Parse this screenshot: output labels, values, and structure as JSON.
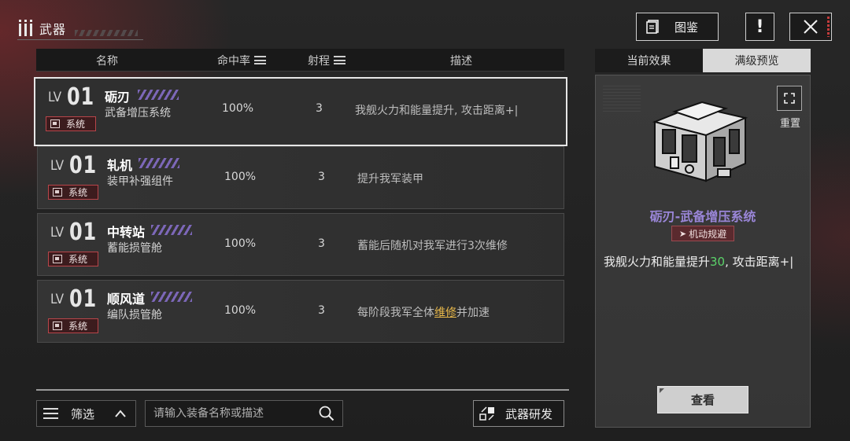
{
  "header": {
    "title": "武器",
    "atlas_label": "图鉴",
    "alert_label": "!"
  },
  "table": {
    "columns": {
      "name": "名称",
      "hit": "命中率",
      "range": "射程",
      "desc": "描述"
    },
    "rows": [
      {
        "lv": "LV",
        "lv_num": "01",
        "name": "砺刃",
        "sub": "武备增压系统",
        "tag": "系统",
        "hit": "100%",
        "range": "3",
        "desc": "我舰火力和能量提升, 攻击距离+|",
        "desc_hl": "",
        "desc_after": "",
        "selected": true
      },
      {
        "lv": "LV",
        "lv_num": "01",
        "name": "轧机",
        "sub": "装甲补强组件",
        "tag": "系统",
        "hit": "100%",
        "range": "3",
        "desc": "提升我军装甲",
        "desc_hl": "",
        "desc_after": ""
      },
      {
        "lv": "LV",
        "lv_num": "01",
        "name": "中转站",
        "sub": "蓄能损管舱",
        "tag": "系统",
        "hit": "100%",
        "range": "3",
        "desc": "蓄能后随机对我军进行3次维修",
        "desc_hl": "",
        "desc_after": ""
      },
      {
        "lv": "LV",
        "lv_num": "01",
        "name": "顺风道",
        "sub": "编队损管舱",
        "tag": "系统",
        "hit": "100%",
        "range": "3",
        "desc": "每阶段我军全体",
        "desc_hl": "维修",
        "desc_after": "并加速"
      }
    ]
  },
  "panel": {
    "tabs": [
      "当前效果",
      "满级预览"
    ],
    "active_tab": 1,
    "reset_label": "重置",
    "item_title": "砺刃-武备增压系统",
    "item_badge": "机动规避",
    "desc_before": "我舰火力和能量提升",
    "desc_num": "30",
    "desc_after": ", 攻击距离+|",
    "view_label": "查看"
  },
  "bottom": {
    "filter_label": "筛选",
    "search_placeholder": "请输入装备名称或描述",
    "dev_label": "武器研发"
  },
  "colors": {
    "accent_purple": "#9a86d8",
    "tag_red": "#b8454a",
    "highlight": "#e8b84a",
    "positive": "#5bd36a"
  }
}
